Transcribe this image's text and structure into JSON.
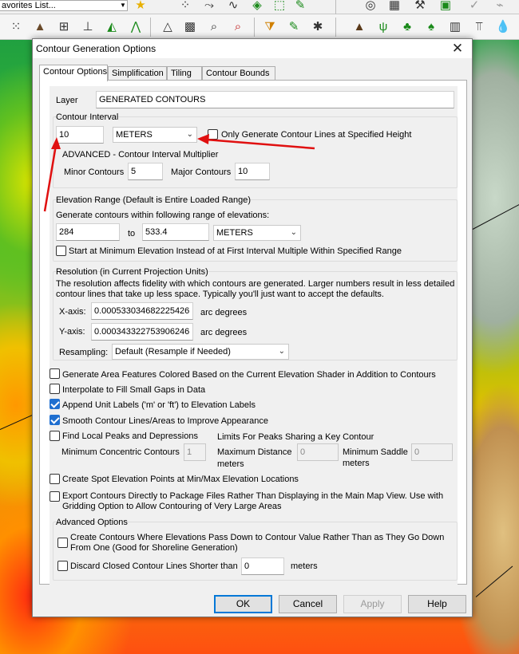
{
  "toolbar": {
    "favorites_text": "avorites List..."
  },
  "dialog": {
    "title": "Contour Generation Options",
    "tabs": [
      "Contour Options",
      "Simplification",
      "Tiling",
      "Contour Bounds"
    ],
    "layer": {
      "label": "Layer",
      "value": "GENERATED CONTOURS"
    },
    "contour_interval": {
      "group_label": "Contour Interval",
      "value": "10",
      "unit": "METERS",
      "only_specified_height_label": "Only Generate Contour Lines at Specified Height",
      "only_specified_height_checked": false,
      "advanced_label": "ADVANCED - Contour Interval Multiplier",
      "minor_label": "Minor Contours",
      "minor_value": "5",
      "major_label": "Major Contours",
      "major_value": "10"
    },
    "elevation_range": {
      "group_label": "Elevation Range (Default is Entire Loaded Range)",
      "description": "Generate contours within following range of elevations:",
      "min": "284",
      "to_label": "to",
      "max": "533.4",
      "unit": "METERS",
      "start_at_min_label": "Start at Minimum Elevation Instead of at First Interval Multiple Within Specified Range",
      "start_at_min_checked": false
    },
    "resolution": {
      "group_label": "Resolution (in Current Projection Units)",
      "description_line1": "The resolution affects fidelity with which contours are generated. Larger numbers result in less detailed",
      "description_line2": "contour lines that take up less space. Typically you'll just want to accept the defaults.",
      "x_label": "X-axis:",
      "x_value": "0.000533034682225426",
      "x_unit": "arc degrees",
      "y_label": "Y-axis:",
      "y_value": "0.000343322753906246",
      "y_unit": "arc degrees",
      "resampling_label": "Resampling:",
      "resampling_value": "Default (Resample if Needed)"
    },
    "options": {
      "area_features_label": "Generate Area Features Colored Based on the Current Elevation Shader in Addition to Contours",
      "area_features_checked": false,
      "interpolate_label": "Interpolate to Fill Small Gaps in Data",
      "interpolate_checked": false,
      "append_units_label": "Append Unit Labels ('m' or 'ft') to Elevation Labels",
      "append_units_checked": true,
      "smooth_label": "Smooth Contour Lines/Areas to Improve Appearance",
      "smooth_checked": true,
      "find_peaks_label": "Find Local Peaks and Depressions",
      "find_peaks_checked": false,
      "limits_label": "Limits For Peaks Sharing a Key Contour",
      "min_concentric_label": "Minimum  Concentric Contours",
      "min_concentric_value": "1",
      "max_distance_label_1": "Maximum Distance",
      "max_distance_label_2": "meters",
      "max_distance_value": "0",
      "min_saddle_label_1": "Minimum Saddle",
      "min_saddle_label_2": "meters",
      "min_saddle_value": "0",
      "spot_elevation_label": "Create Spot Elevation Points at Min/Max Elevation Locations",
      "spot_elevation_checked": false,
      "export_label_line1": "Export Contours Directly to Package Files Rather Than Displaying in the Main Map View. Use with",
      "export_label_line2": "Gridding Option to Allow Contouring of Very Large Areas",
      "export_checked": false
    },
    "advanced": {
      "group_label": "Advanced Options",
      "pass_down_line1": "Create Contours Where Elevations Pass Down to Contour Value Rather Than as They Go Down",
      "pass_down_line2": "From One (Good for Shoreline Generation)",
      "pass_down_checked": false,
      "discard_label": "Discard Closed Contour Lines Shorter than",
      "discard_value": "0",
      "discard_unit": "meters",
      "discard_checked": false
    },
    "buttons": {
      "ok": "OK",
      "cancel": "Cancel",
      "apply": "Apply",
      "help": "Help"
    }
  },
  "colors": {
    "accent": "#0078d7",
    "checkbox_checked": "#1f6fd0",
    "annotation_arrow": "#e01010"
  }
}
